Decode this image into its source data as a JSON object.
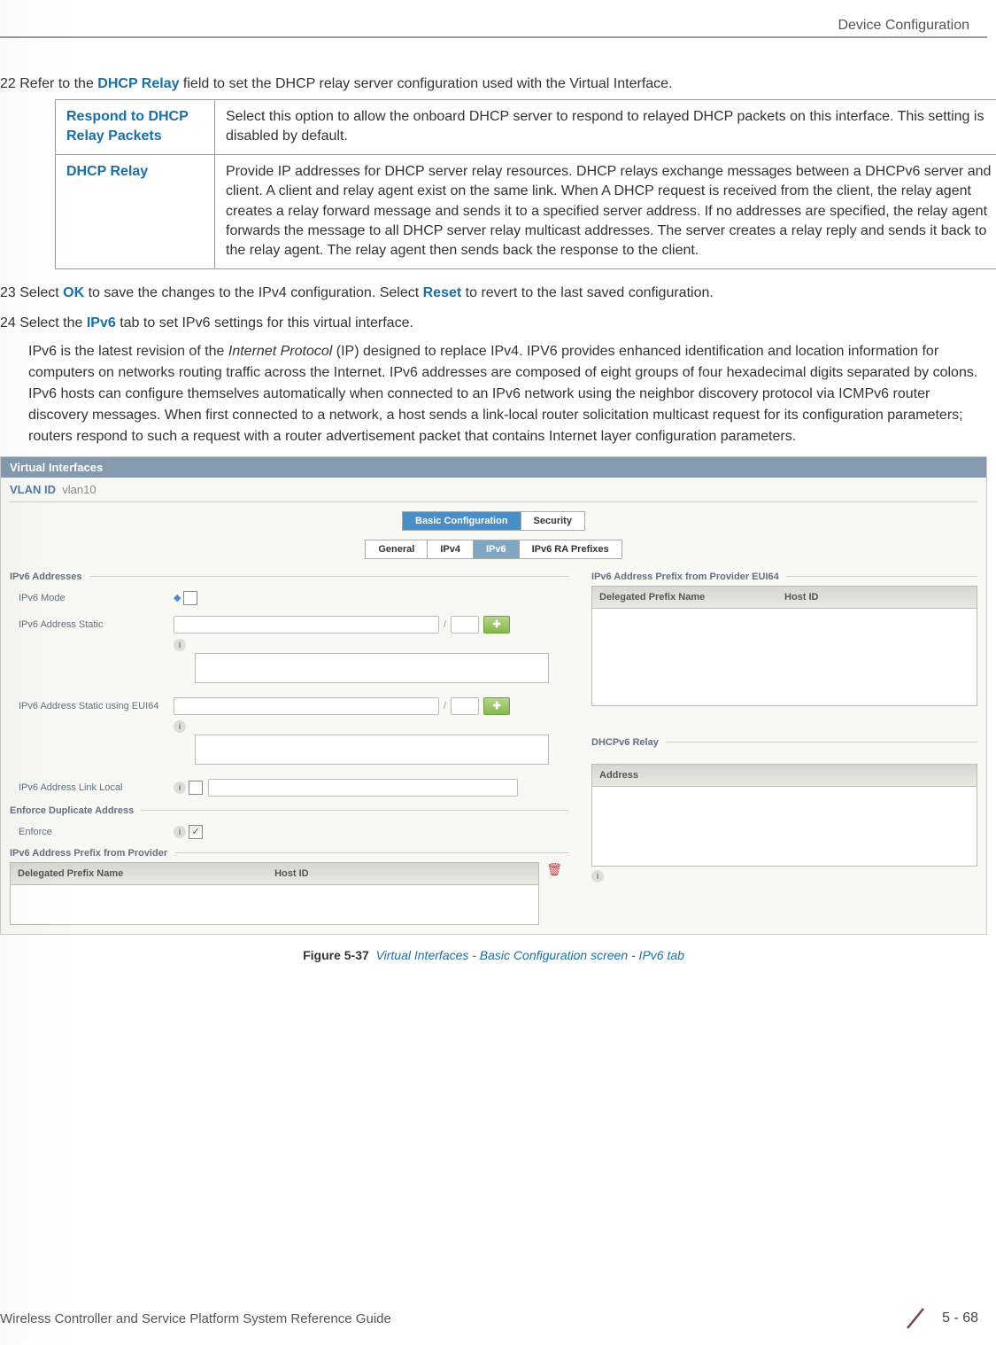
{
  "header": {
    "section": "Device Configuration"
  },
  "step22": {
    "prefix": "22 Refer to the ",
    "bold": "DHCP Relay",
    "suffix": " field to set the DHCP relay server configuration used with the Virtual Interface."
  },
  "table": {
    "row1": {
      "label": "Respond to DHCP Relay Packets",
      "desc": "Select this option to allow the onboard DHCP server to respond to relayed DHCP packets on this interface. This setting is disabled by default."
    },
    "row2": {
      "label": "DHCP Relay",
      "desc": "Provide IP addresses for DHCP server relay resources. DHCP relays exchange messages between a DHCPv6 server and client. A client and relay agent exist on the same link. When A DHCP request is received from the client, the relay agent creates a relay forward message and sends it to a specified server address. If no addresses are specified, the relay agent forwards the message to all DHCP server relay multicast addresses. The server creates a relay reply and sends it back to the relay agent. The relay agent then sends back the response to the client."
    }
  },
  "step23": {
    "prefix": "23 Select ",
    "ok": "OK",
    "mid": " to save the changes to the IPv4 configuration. Select ",
    "reset": "Reset",
    "suffix": " to revert to the last saved configuration."
  },
  "step24": {
    "prefix": "24 Select the ",
    "ipv6": "IPv6",
    "suffix": " tab to set IPv6 settings for this virtual interface."
  },
  "body_para": "IPv6 is the latest revision of the Internet Protocol (IP) designed to replace IPv4. IPV6 provides enhanced identification and location information for computers on networks routing traffic across the Internet. IPv6 addresses are composed of eight groups of four hexadecimal digits separated by colons. IPv6 hosts can configure themselves automatically when connected to an IPv6 network using the neighbor discovery protocol via ICMPv6 router discovery messages. When first connected to a network, a host sends a link-local router solicitation multicast request for its configuration parameters; routers respond to such a request with a router advertisement packet that contains Internet layer configuration parameters.",
  "screenshot": {
    "title": "Virtual Interfaces",
    "vlan_label": "VLAN ID",
    "vlan_id": "vlan10",
    "tabs1": {
      "basic": "Basic Configuration",
      "security": "Security"
    },
    "tabs2": {
      "general": "General",
      "ipv4": "IPv4",
      "ipv6": "IPv6",
      "ra": "IPv6 RA Prefixes"
    },
    "left": {
      "section1": "IPv6 Addresses",
      "row1": "IPv6 Mode",
      "row2": "IPv6 Address Static",
      "row3": "IPv6 Address Static using EUI64",
      "row4": "IPv6 Address Link Local",
      "section2": "Enforce Duplicate Address",
      "row5": "Enforce",
      "section3": "IPv6 Address Prefix from Provider",
      "col_a": "Delegated Prefix Name",
      "col_b": "Host ID"
    },
    "right": {
      "section1": "IPv6 Address Prefix from Provider EUI64",
      "col_a": "Delegated Prefix Name",
      "col_b": "Host ID",
      "section2": "DHCPv6 Relay",
      "col_addr": "Address"
    }
  },
  "figure": {
    "label": "Figure 5-37",
    "text": "Virtual Interfaces - Basic Configuration screen - IPv6 tab"
  },
  "footer": {
    "left": "Wireless Controller and Service Platform System Reference Guide",
    "page": "5 - 68"
  }
}
